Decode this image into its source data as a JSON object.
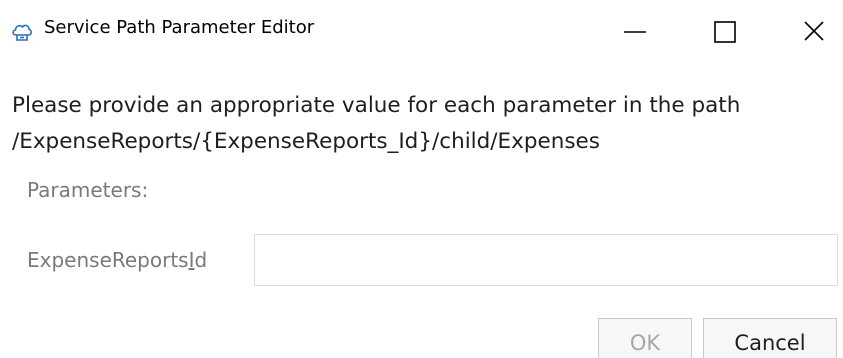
{
  "window": {
    "title": "Service Path Parameter Editor",
    "icon": "cloud-service-icon",
    "controls": {
      "minimize_icon": "minimize-icon",
      "maximize_icon": "maximize-icon",
      "close_icon": "close-icon"
    }
  },
  "message": {
    "line1": "Please provide an appropriate value for each parameter in the path",
    "line2": "/ExpenseReports/{ExpenseReports_Id}/child/Expenses"
  },
  "parameters": {
    "heading": "Parameters:",
    "fields": [
      {
        "label_main": "ExpenseReports",
        "label_mnemonic": "I",
        "label_tail": "d",
        "value": "",
        "placeholder": ""
      }
    ]
  },
  "buttons": {
    "ok_label": "OK",
    "ok_enabled": false,
    "cancel_label": "Cancel"
  },
  "colors": {
    "text": "#1e1e1e",
    "muted_text": "#7a7a7a",
    "disabled_text": "#a6a6a6",
    "icon_accent": "#2a6fb8",
    "border": "#dcdcdc"
  }
}
